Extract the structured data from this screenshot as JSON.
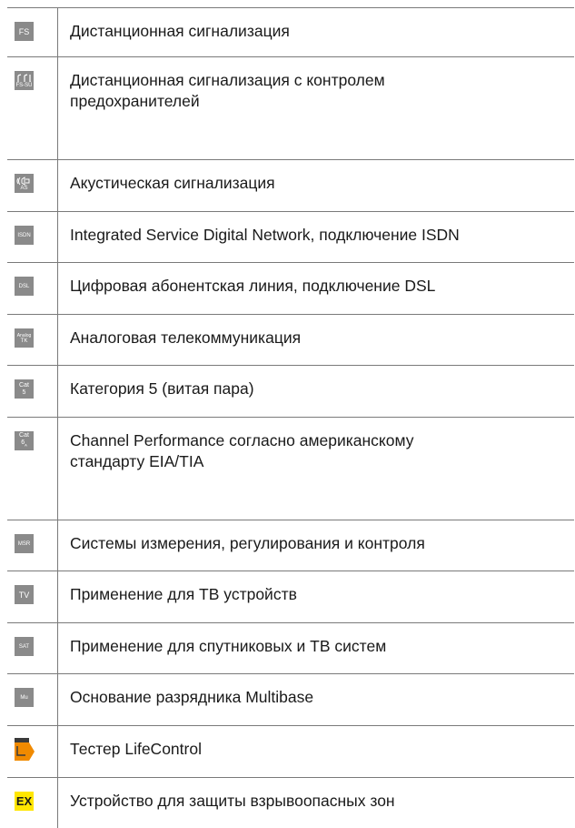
{
  "rows": [
    {
      "icon": "FS",
      "icon_name": "fs-icon",
      "text": "Дистанционная сигнализация"
    },
    {
      "icon": "FS-SÜ",
      "icon_name": "fs-su-icon",
      "text": "Дистанционная сигнализация с контролем предохранителей"
    },
    {
      "icon": "AS",
      "icon_name": "as-icon",
      "text": "Акустическая сигнализация"
    },
    {
      "icon": "ISDN",
      "icon_name": "isdn-icon",
      "text": "Integrated Service Digital Network, подключение ISDN"
    },
    {
      "icon": "DSL",
      "icon_name": "dsl-icon",
      "text": "Цифровая абонентская линия, подключение DSL"
    },
    {
      "icon_l1": "Analog",
      "icon_l2": "TK",
      "icon_name": "analog-tk-icon",
      "text": "Аналоговая телекоммуникация"
    },
    {
      "icon_l1": "Cat",
      "icon_l2": "5",
      "icon_name": "cat5-icon",
      "text": "Категория 5 (витая пара)"
    },
    {
      "icon_l1": "Cat",
      "icon_l2": "6",
      "icon_sub": "A",
      "icon_name": "cat6a-icon",
      "text": "Channel Performance согласно американскому стандарту  EIA/TIA"
    },
    {
      "icon": "MSR",
      "icon_name": "msr-icon",
      "text": "Системы измерения, регулирования и контроля"
    },
    {
      "icon": "TV",
      "icon_name": "tv-icon",
      "text": "Применение для ТВ устройств"
    },
    {
      "icon": "SAT",
      "icon_name": "sat-icon",
      "text": "Применение для спутниковых и ТВ систем"
    },
    {
      "icon": "Mu",
      "icon_name": "mu-icon",
      "text": "Основание разрядника Multibase"
    },
    {
      "icon": "Life Control",
      "icon_name": "lifecontrol-icon",
      "text": "Тестер LifeControl"
    },
    {
      "icon": "EX",
      "icon_name": "ex-icon",
      "text": "Устройство для защиты взрывоопасных зон"
    }
  ],
  "colors": {
    "badge": "#8a8a8a",
    "ex_badge": "#ffe600",
    "lifecontrol": "#f08a00",
    "rule": "#7a7a7a"
  }
}
